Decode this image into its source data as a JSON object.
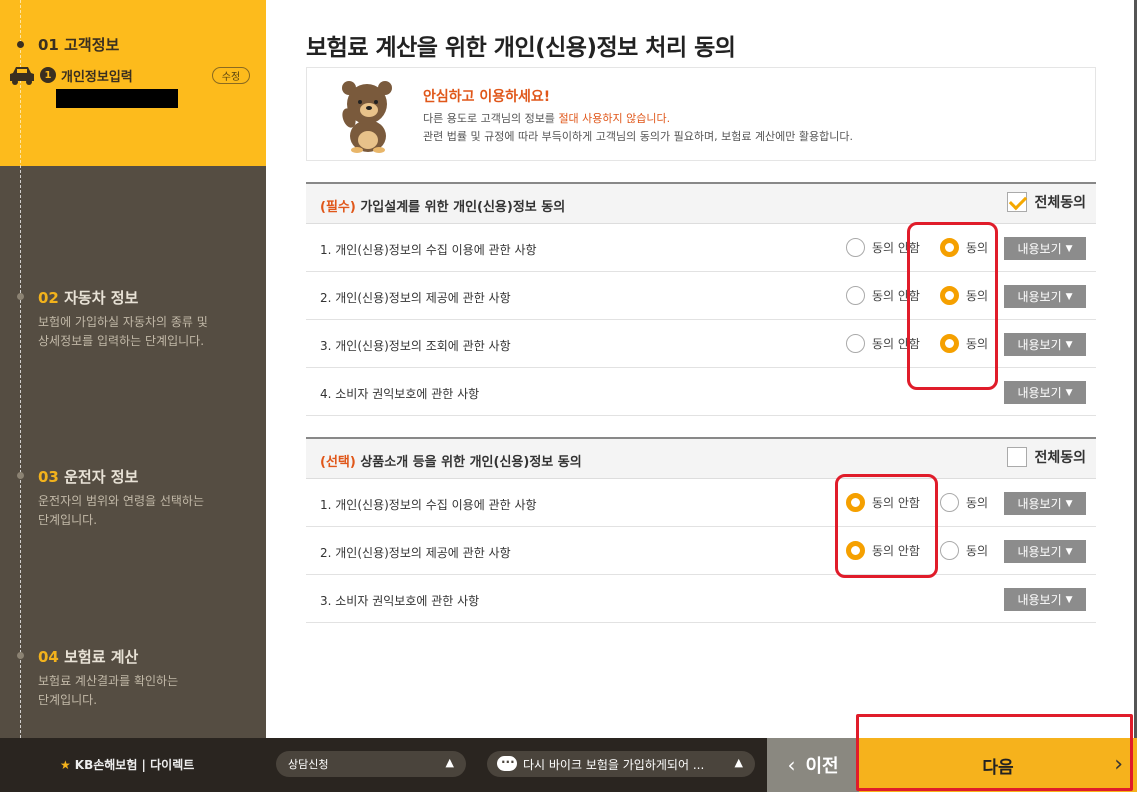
{
  "sidebar": {
    "step1": {
      "title": "01 고객정보",
      "sub_num": "1",
      "sub_label": "개인정보입력",
      "edit_label": "수정"
    },
    "step2": {
      "num": "02",
      "title": "자동차 정보",
      "desc1": "보험에 가입하실 자동차의 종류 및",
      "desc2": "상세정보를 입력하는 단계입니다."
    },
    "step3": {
      "num": "03",
      "title": "운전자 정보",
      "desc1": "운전자의 범위와 연령을 선택하는",
      "desc2": "단계입니다."
    },
    "step4": {
      "num": "04",
      "title": "보험료 계산",
      "desc1": "보험료 계산결과를 확인하는",
      "desc2": "단계입니다."
    }
  },
  "main": {
    "title": "보험료 계산을 위한 개인(신용)정보 처리 동의",
    "notice": {
      "head": "안심하고 이용하세요!",
      "line1_pre": "다른 용도로 고객님의 정보를 ",
      "line1_hl": "절대 사용하지 않습니다.",
      "line2": "관련 법률 및 규정에 따라 부득이하게 고객님의 동의가 필요하며, 보험료 계산에만 활용합니다."
    },
    "required": {
      "tag": "(필수)",
      "title": " 가입설계를 위한 개인(신용)정보 동의",
      "agree_all": "전체동의",
      "agree_all_checked": true,
      "rows": [
        {
          "label": "1. 개인(신용)정보의 수집 이용에 관한 사항",
          "disagree": "동의 안함",
          "agree": "동의",
          "selected": "agree",
          "detail": "내용보기"
        },
        {
          "label": "2. 개인(신용)정보의 제공에 관한 사항",
          "disagree": "동의 안함",
          "agree": "동의",
          "selected": "agree",
          "detail": "내용보기"
        },
        {
          "label": "3. 개인(신용)정보의 조회에 관한 사항",
          "disagree": "동의 안함",
          "agree": "동의",
          "selected": "agree",
          "detail": "내용보기"
        },
        {
          "label": "4. 소비자 권익보호에 관한 사항",
          "detail": "내용보기"
        }
      ]
    },
    "optional": {
      "tag": "(선택)",
      "title": " 상품소개 등을 위한 개인(신용)정보 동의",
      "agree_all": "전체동의",
      "agree_all_checked": false,
      "rows": [
        {
          "label": "1. 개인(신용)정보의 수집 이용에 관한 사항",
          "disagree": "동의 안함",
          "agree": "동의",
          "selected": "disagree",
          "detail": "내용보기"
        },
        {
          "label": "2. 개인(신용)정보의 제공에 관한 사항",
          "disagree": "동의 안함",
          "agree": "동의",
          "selected": "disagree",
          "detail": "내용보기"
        },
        {
          "label": "3. 소비자 권익보호에 관한 사항",
          "detail": "내용보기"
        }
      ]
    }
  },
  "bottom": {
    "logo": "KB손해보험 | 다이렉트",
    "consult": "상담신청",
    "chat": "다시 바이크 보험을 가입하게되어 ...",
    "prev": "이전",
    "next": "다음"
  },
  "colors": {
    "accent": "#f6b21c",
    "sidebar": "#554d42",
    "highlight_red": "#e01c2a",
    "orange_text": "#e0571a"
  }
}
